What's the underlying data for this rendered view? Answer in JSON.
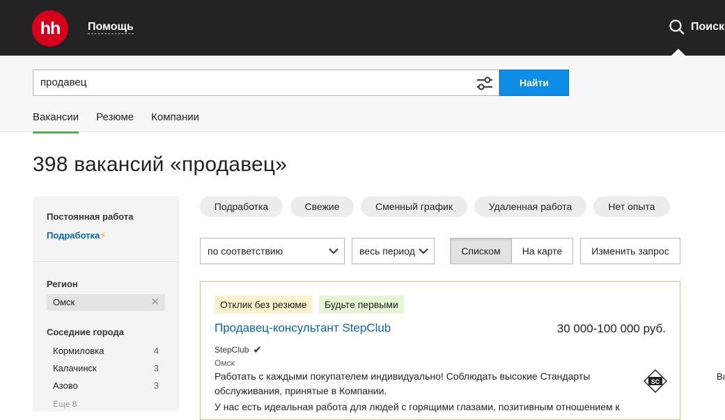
{
  "header": {
    "logo_text": "hh",
    "help_label": "Помощь",
    "search_label": "Поиск"
  },
  "search": {
    "query": "продавец",
    "button_label": "Найти"
  },
  "tabs": [
    {
      "label": "Вакансии"
    },
    {
      "label": "Резюме"
    },
    {
      "label": "Компании"
    }
  ],
  "results_title": "398 вакансий «продавец»",
  "sidebar": {
    "employment_title": "Постоянная работа",
    "employment_link": "Подработка",
    "region_title": "Регион",
    "region_value": "Омск",
    "nearby_title": "Соседние города",
    "cities": [
      {
        "name": "Кормиловка",
        "count": "4"
      },
      {
        "name": "Калачинск",
        "count": "3"
      },
      {
        "name": "Азово",
        "count": "3"
      }
    ],
    "more_label": "Еще 8"
  },
  "chips": [
    {
      "label": "Подработка"
    },
    {
      "label": "Свежие"
    },
    {
      "label": "Сменный график"
    },
    {
      "label": "Удаленная работа"
    },
    {
      "label": "Нет опыта"
    }
  ],
  "controls": {
    "sort_value": "по соответствию",
    "period_value": "весь период",
    "view_list": "Списком",
    "view_map": "На карте",
    "edit_query": "Изменить запрос"
  },
  "vacancy": {
    "badge_no_resume": "Отклик без резюме",
    "badge_first": "Будьте первыми",
    "title": "Продавец-консультант StepClub",
    "salary": "30 000-100 000 руб.",
    "company": "StepClub",
    "city": "Омск",
    "description": "Работать с каждыми покупателем индивидуально! Соблюдать высокие Стандарты обслуживания, принятые в Компании.",
    "description2": "У нас есть идеальная работа для людей с горящими глазами, позитивным отношением к",
    "logo_text": "SC"
  },
  "edge_text": "Вı",
  "colors": {
    "brand_red": "#d6001c",
    "primary_blue": "#0d8de6",
    "link_blue": "#0b64b3",
    "tab_underline": "#4bb34b"
  }
}
